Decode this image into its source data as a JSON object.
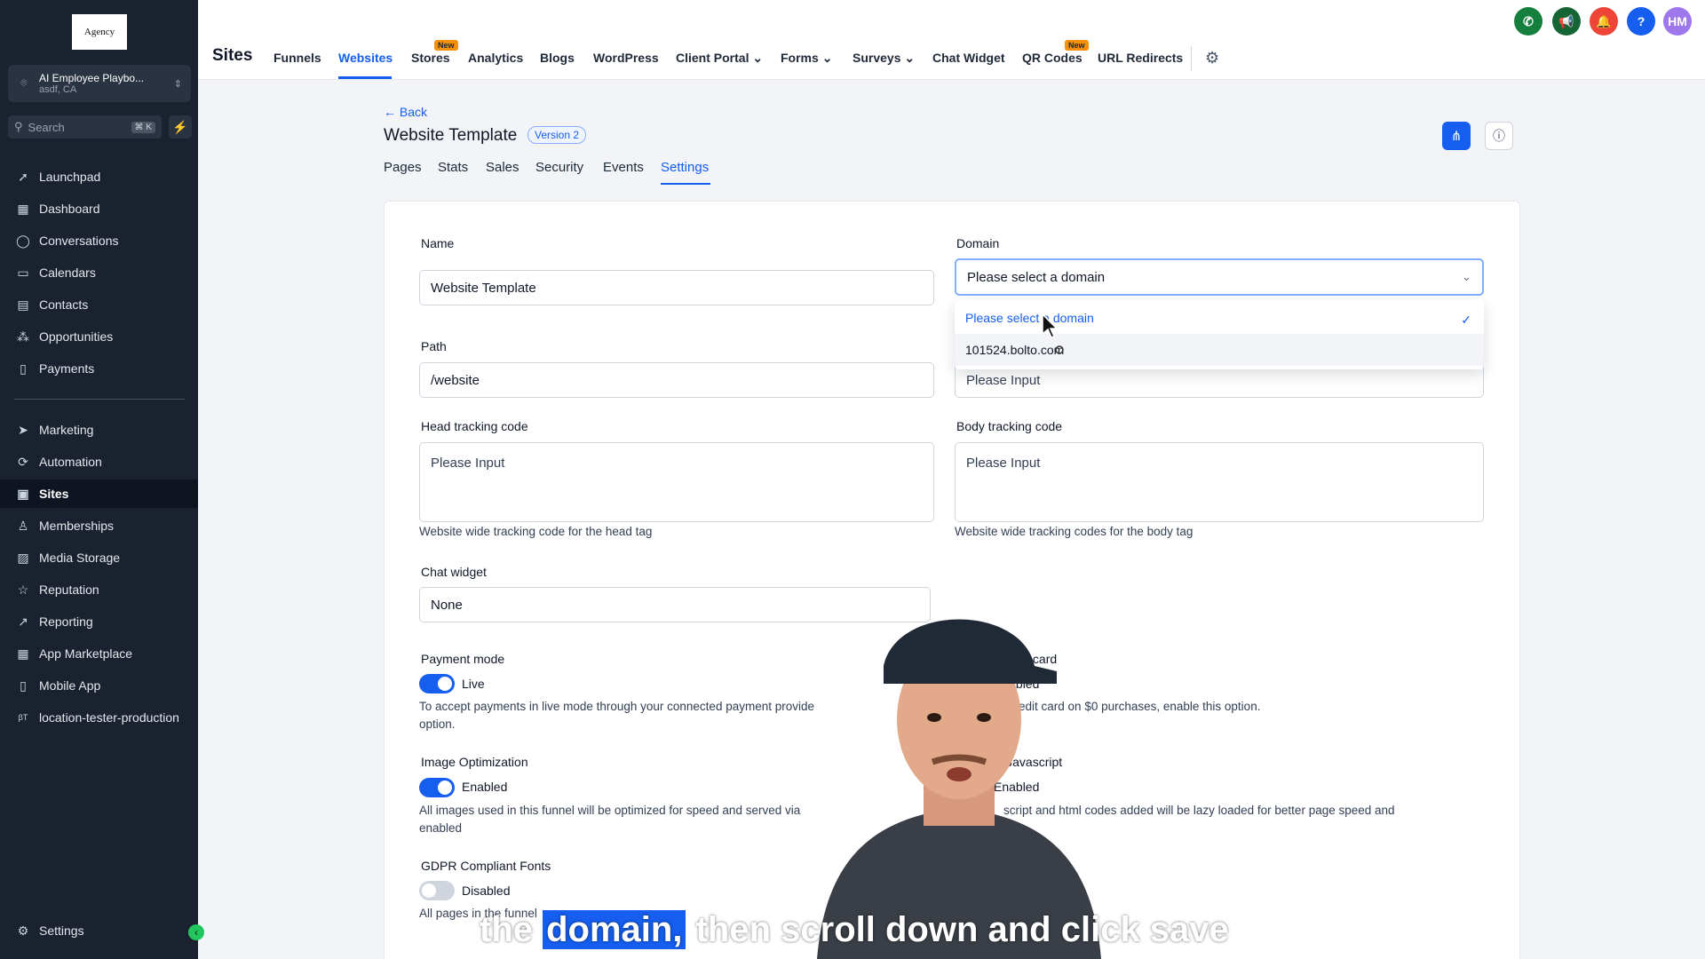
{
  "sidebar": {
    "logo_text": "Agency",
    "account": {
      "name": "AI Employee Playbo...",
      "location": "asdf, CA"
    },
    "search": {
      "placeholder": "Search",
      "shortcut": "⌘ K"
    },
    "items": [
      {
        "label": "Launchpad",
        "icon": "rocket-icon"
      },
      {
        "label": "Dashboard",
        "icon": "grid-icon"
      },
      {
        "label": "Conversations",
        "icon": "chat-icon"
      },
      {
        "label": "Calendars",
        "icon": "calendar-icon"
      },
      {
        "label": "Contacts",
        "icon": "contacts-icon"
      },
      {
        "label": "Opportunities",
        "icon": "opportunities-icon"
      },
      {
        "label": "Payments",
        "icon": "payments-icon"
      },
      {
        "label": "Marketing",
        "icon": "send-icon"
      },
      {
        "label": "Automation",
        "icon": "automation-icon"
      },
      {
        "label": "Sites",
        "icon": "sites-icon",
        "active": true
      },
      {
        "label": "Memberships",
        "icon": "memberships-icon"
      },
      {
        "label": "Media Storage",
        "icon": "media-icon"
      },
      {
        "label": "Reputation",
        "icon": "star-icon"
      },
      {
        "label": "Reporting",
        "icon": "reporting-icon"
      },
      {
        "label": "App Marketplace",
        "icon": "apps-icon"
      },
      {
        "label": "Mobile App",
        "icon": "mobile-icon"
      },
      {
        "label": "location-tester-production",
        "icon": "beta-icon"
      }
    ],
    "settings_label": "Settings"
  },
  "topbar": {
    "title": "Sites",
    "nav": [
      "Funnels",
      "Websites",
      "Stores",
      "Analytics",
      "Blogs",
      "WordPress",
      "Client Portal",
      "Forms",
      "Surveys",
      "Chat Widget",
      "QR Codes",
      "URL Redirects"
    ],
    "new_badge": "New",
    "avatar_initials": "HM",
    "colors": {
      "phone": "#15803d",
      "megaphone": "#166534",
      "bell": "#f04438",
      "help": "#155eef",
      "avatar": "#9e77ed"
    }
  },
  "page": {
    "back_label": "Back",
    "title": "Website Template",
    "version_badge": "Version 2",
    "tabs": [
      "Pages",
      "Stats",
      "Sales",
      "Security",
      "Events",
      "Settings"
    ],
    "active_tab": "Settings"
  },
  "form": {
    "name_label": "Name",
    "name_value": "Website Template",
    "domain_label": "Domain",
    "domain_value": "Please select a domain",
    "domain_options": [
      "Please select a domain",
      "101524.bolto.com"
    ],
    "path_label": "Path",
    "path_value": "/website",
    "favicon_placeholder": "Please Input",
    "head_label": "Head tracking code",
    "head_placeholder": "Please Input",
    "head_help": "Website wide tracking code for the head tag",
    "body_label": "Body tracking code",
    "body_placeholder": "Please Input",
    "body_help": "Website wide tracking codes for the body tag",
    "chat_label": "Chat widget",
    "chat_value": "None",
    "payment_label": "Payment mode",
    "payment_value": "Live",
    "payment_help": "To accept payments in live mode through your connected payment provide",
    "payment_help_2": "option.",
    "credit_label": "equire credit card",
    "credit_value": "Enabled",
    "credit_help": "require credit card on $0 purchases, enable this option.",
    "image_label": "Image Optimization",
    "image_value": "Enabled",
    "image_help": "All images used in this funnel will be optimized for speed and served via",
    "image_help_2": "enabled",
    "js_label": "Optimize Javascript",
    "js_value": "Enabled",
    "js_help": "script and html codes added will be lazy loaded for better page speed and",
    "gdpr_label": "GDPR Compliant Fonts",
    "gdpr_value": "Disabled",
    "gdpr_help": "All pages in the funnel"
  },
  "caption": {
    "pre": "the",
    "highlight": "domain,",
    "post": "then scroll down and click save"
  }
}
